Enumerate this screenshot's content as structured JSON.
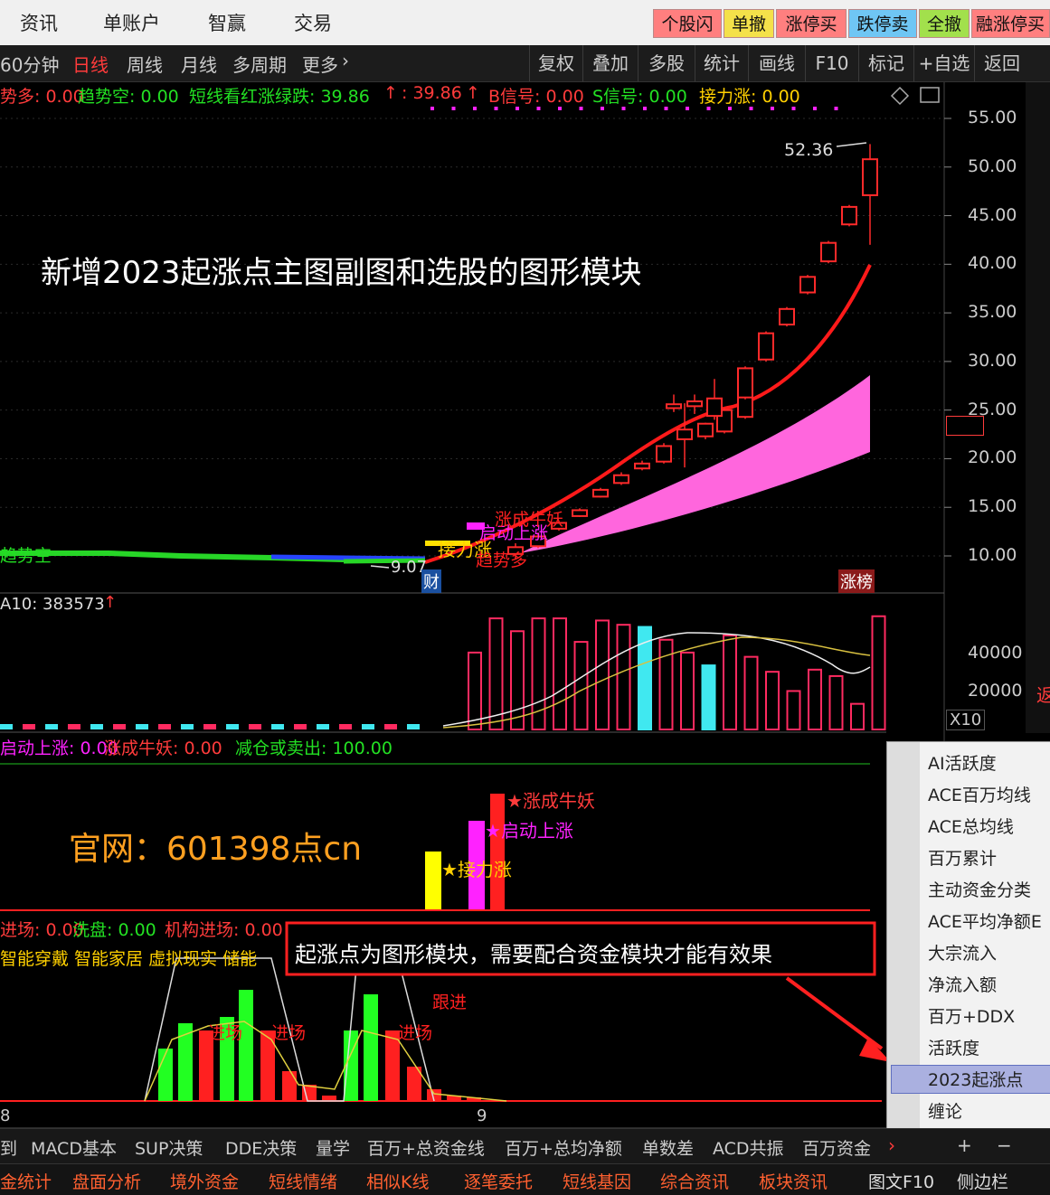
{
  "top_nav": [
    "资讯",
    "单账户",
    "智赢",
    "交易"
  ],
  "quick_buttons": [
    "个股闪",
    "单撤",
    "涨停买",
    "跌停卖",
    "全撤",
    "融涨停买"
  ],
  "period_tabs": [
    "60分钟",
    "日线",
    "周线",
    "月线",
    "多周期",
    "更多"
  ],
  "right_tools": [
    "复权",
    "叠加",
    "多股",
    "统计",
    "画线",
    "F10",
    "标记",
    "+自选",
    "返回"
  ],
  "indicator_line": {
    "t1": "势多: 0.00",
    "t2": "趋势空: 0.00",
    "t3": "短线看红涨绿跌: 39.86",
    "t4": ": 39.86",
    "t5": "B信号: 0.00",
    "t6": "S信号: 0.00",
    "t7": "接力涨: 0.00"
  },
  "price_axis": [
    "55.00",
    "50.00",
    "45.00",
    "40.00",
    "35.00",
    "30.00",
    "25.00",
    "20.00",
    "15.00",
    "10.00"
  ],
  "volume_axis": [
    "40000",
    "20000"
  ],
  "volume_unit": "X10",
  "annotations": {
    "headline": "新增2023起涨点主图副图和选股的图形模块",
    "high_label": "52.36",
    "low_label": "9.07",
    "cai": "财",
    "zhangbang": "涨榜",
    "trend_empty": "趋势空",
    "relay": "接力涨",
    "start_up": "启动上涨",
    "bull": "涨成牛妖",
    "trend_more": "趋势多",
    "website": "官网：601398点cn",
    "notice": "起涨点为图形模块，需要配合资金模块才能有效果",
    "follow": "跟进",
    "enter1": "进场",
    "enter2": "进场",
    "enter3": "进场"
  },
  "vol_indicator": "A10: 383573",
  "sub1_indicator": {
    "a": "启动上涨: 0.00",
    "b": "涨成牛妖: 0.00",
    "c": "减仓或卖出: 100.00"
  },
  "sub1_labels": {
    "bull": "涨成牛妖",
    "start": "启动上涨",
    "relay": "接力涨"
  },
  "sub2_indicator": {
    "a": "进场: 0.00",
    "b": "洗盘: 0.00",
    "c": "机构进场: 0.00"
  },
  "sub2_concepts": "智能穿戴 智能家居 虚拟现实 储能",
  "time_axis": [
    "8",
    "9"
  ],
  "side_menu": [
    "AI活跃度",
    "ACE百万均线",
    "ACE总均线",
    "百万累计",
    "主动资金分类",
    "ACE平均净额E",
    "大宗流入",
    "净流入额",
    "百万+DDX",
    "活跃度",
    "2023起涨点",
    "缠论"
  ],
  "side_menu_selected": "2023起涨点",
  "bottom_tabs_1": [
    "到",
    "MACD基本",
    "SUP决策",
    "DDE决策",
    "量学",
    "百万+总资金线",
    "百万+总均净额",
    "单数差",
    "ACD共振",
    "百万资金"
  ],
  "bottom_tabs_1_controls": [
    "+",
    "−"
  ],
  "bottom_tabs_2": [
    "金统计",
    "盘面分析",
    "境外资金",
    "短线情绪",
    "相似K线",
    "逐笔委托",
    "短线基因",
    "综合资讯",
    "板块资讯",
    "图文F10",
    "侧边栏"
  ],
  "chart_data": {
    "type": "candlestick",
    "y_range": [
      7.5,
      57.5
    ],
    "candles": [
      {
        "o": 10.2,
        "c": 10.9,
        "h": 11.3,
        "l": 9.7
      },
      {
        "o": 11.0,
        "c": 12.0,
        "h": 12.4,
        "l": 10.8
      },
      {
        "o": 12.8,
        "c": 13.4,
        "h": 13.6,
        "l": 12.6
      },
      {
        "o": 14.1,
        "c": 14.7,
        "h": 14.9,
        "l": 14.0
      },
      {
        "o": 16.1,
        "c": 16.8,
        "h": 17.0,
        "l": 16.0
      },
      {
        "o": 17.5,
        "c": 18.3,
        "h": 18.6,
        "l": 17.3
      },
      {
        "o": 19.0,
        "c": 19.5,
        "h": 19.8,
        "l": 18.8
      },
      {
        "o": 19.7,
        "c": 21.3,
        "h": 21.6,
        "l": 19.5
      },
      {
        "o": 22.0,
        "c": 23.0,
        "h": 25.7,
        "l": 19.1
      },
      {
        "o": 22.3,
        "c": 23.6,
        "h": 23.7,
        "l": 22.0
      },
      {
        "o": 22.8,
        "c": 25.0,
        "h": 25.2,
        "l": 22.6
      },
      {
        "o": 24.3,
        "c": 26.6,
        "h": 26.8,
        "l": 24.1
      },
      {
        "o": 25.2,
        "c": 25.6,
        "h": 26.6,
        "l": 24.8
      },
      {
        "o": 25.4,
        "c": 25.9,
        "h": 26.6,
        "l": 24.6
      },
      {
        "o": 24.4,
        "c": 26.2,
        "h": 28.2,
        "l": 24.0
      },
      {
        "o": 26.3,
        "c": 29.3,
        "h": 29.5,
        "l": 26.1
      },
      {
        "o": 30.2,
        "c": 32.9,
        "h": 33.1,
        "l": 30.0
      },
      {
        "o": 33.8,
        "c": 35.4,
        "h": 35.6,
        "l": 33.6
      },
      {
        "o": 37.1,
        "c": 38.7,
        "h": 38.9,
        "l": 36.9
      },
      {
        "o": 40.3,
        "c": 42.2,
        "h": 42.4,
        "l": 40.1
      },
      {
        "o": 44.1,
        "c": 45.9,
        "h": 46.1,
        "l": 43.9
      },
      {
        "o": 47.1,
        "c": 50.8,
        "h": 52.36,
        "l": 42.0
      }
    ],
    "volume_y_range": [
      0,
      55000
    ],
    "volume": [
      8000,
      9000,
      9000,
      8000,
      8500,
      10000,
      15000,
      16000,
      16000,
      8500,
      30000,
      36000,
      48000,
      48000,
      34000,
      48000,
      50000,
      48000,
      49000,
      36000,
      52000,
      46000,
      52000,
      52000,
      41000,
      51000,
      49000,
      48000,
      42000,
      36000,
      30000,
      44000,
      34000,
      27000,
      18000,
      28000,
      25000,
      12000,
      53000
    ]
  }
}
